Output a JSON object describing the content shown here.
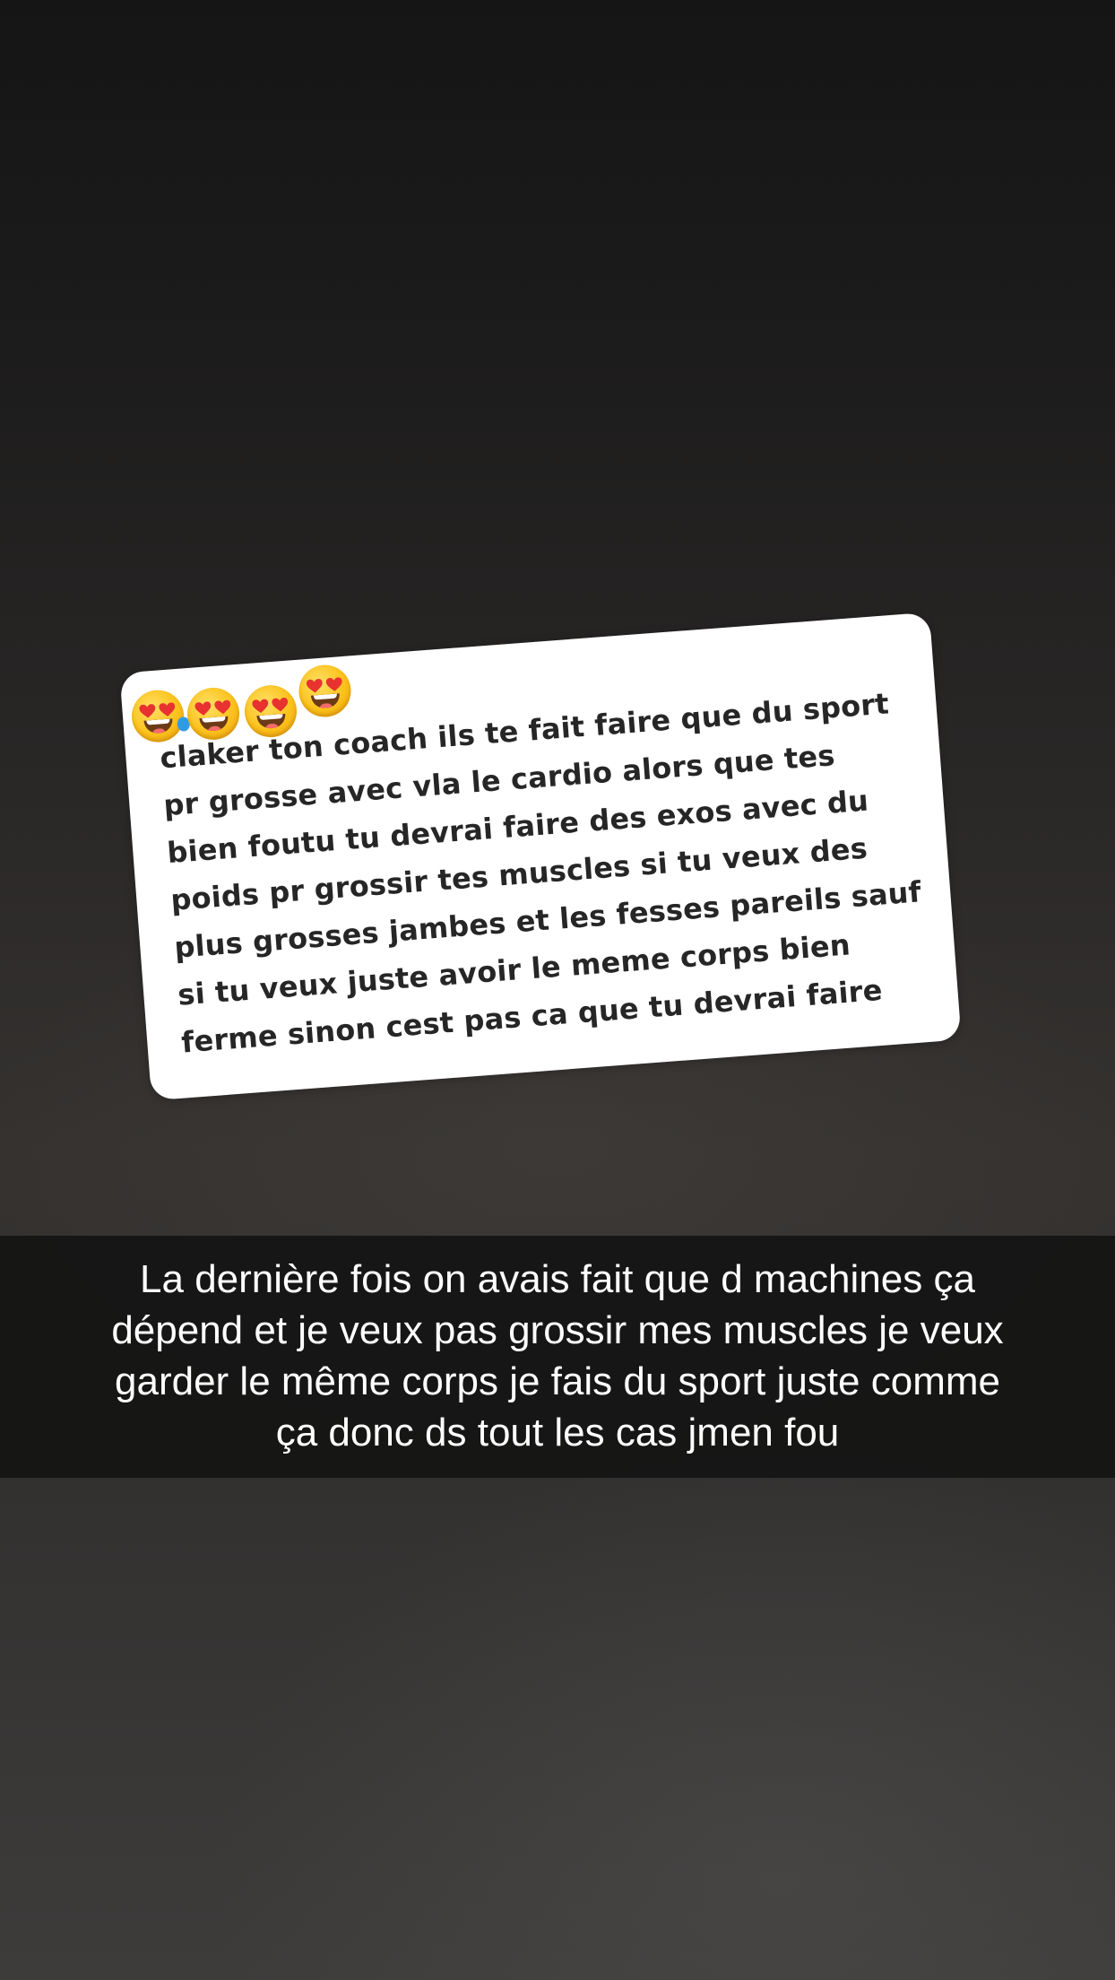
{
  "message_card": {
    "emojis": [
      "smiling-face-with-heart-eyes",
      "smiling-face-with-heart-eyes",
      "smiling-face-with-heart-eyes",
      "smiling-face-with-heart-eyes"
    ],
    "lines": [
      "claker ton coach ils te fait faire que du sport",
      "pr grosse avec vla le cardio alors que tes",
      "bien foutu tu devrai faire des exos avec du",
      "poids pr grossir tes muscles si tu veux des",
      "plus grosses jambes et les fesses pareils sauf",
      "si tu veux juste avoir le meme corps bien",
      "ferme sinon cest pas ca que tu devrai faire"
    ]
  },
  "caption": {
    "lines": [
      "La dernière fois on avais fait que d machines ça",
      "dépend et je veux pas grossir mes muscles je veux",
      "garder le même corps je fais du sport juste comme",
      "ça donc ds tout les cas jmen fou"
    ]
  },
  "colors": {
    "background_dark": "#151515",
    "background_light": "#3e3c3b",
    "card": "#ffffff",
    "card_text": "#262626",
    "caption_bar": "#111111",
    "caption_text": "#ffffff",
    "emoji_face": "#fcc21b",
    "emoji_heart": "#e8322f"
  }
}
